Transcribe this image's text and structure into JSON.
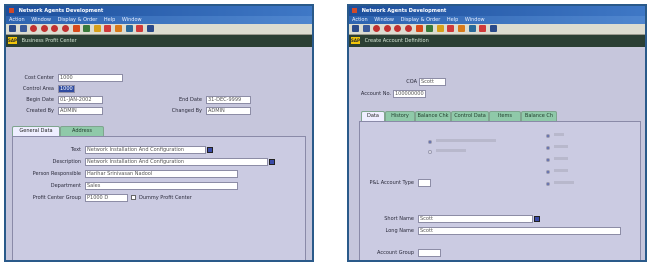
{
  "left": {
    "title": "Network Agents Development",
    "menu": [
      "Action",
      "Window",
      "Display & Order",
      "Help",
      "Window"
    ],
    "header": "Business Profit Center",
    "form": {
      "cost_center_label": "Cost Center",
      "cost_center_value": "1000",
      "control_area_label": "Control Area",
      "control_area_value": "1000",
      "begin_date_label": "Begin Date",
      "begin_date_value": "01-JAN-2002",
      "end_date_label": "End Date",
      "end_date_value": "31-DEC-9999",
      "created_by_label": "Created By",
      "created_by_value": "ADMIN",
      "changed_by_label": "Changed By",
      "changed_by_value": "ADMIN"
    },
    "tabs": [
      "General Data",
      "Address"
    ],
    "tab_form": {
      "text_label": "Text",
      "text_value": "Network Installation And Configuration",
      "description_label": "Description",
      "description_value": "Network Installation And Configuration",
      "person_label": "Person Responsible",
      "person_value": "Harihar Srinivasan Nadool",
      "department_label": "Department",
      "department_value": "Sales",
      "group_label": "Profit Center Group",
      "group_value": "P1000 D",
      "dummy_label": "Dummy Profit Center"
    }
  },
  "right": {
    "title": "Network Agents Development",
    "menu": [
      "Action",
      "Window",
      "Display & Order",
      "Help",
      "Window"
    ],
    "header": "Create Account Definition",
    "form": {
      "coa_label": "COA",
      "coa_value": "Scott",
      "account_no_label": "Account No.",
      "account_no_value": "100000000"
    },
    "tabs": [
      "Data",
      "History",
      "Balance Chk",
      "Control Data",
      "Items",
      "Balance Ch"
    ],
    "tab_form": {
      "pl_type_label": "P&L Account Type",
      "short_name_label": "Short Name",
      "short_name_value": "Scott",
      "long_name_label": "Long Name",
      "long_name_value": "Scott",
      "account_group_label": "Account Group"
    }
  },
  "colors": {
    "titlebar": "#1d4f9c",
    "headerbar": "#2b3f34",
    "content": "#c6c6dc",
    "tab": "#8fc9a9",
    "frame": "#2a5a8a"
  }
}
